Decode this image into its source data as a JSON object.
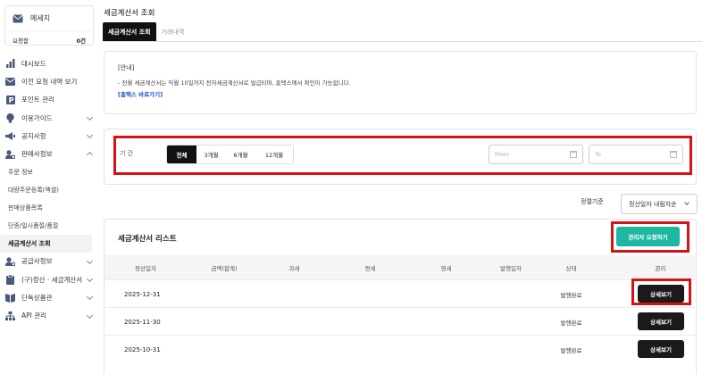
{
  "sidebar": {
    "message": {
      "title": "메세지",
      "request_label": "요청함",
      "request_count": "0건"
    },
    "items": [
      {
        "label": "대시보드",
        "icon": "bar-chart-icon",
        "chevron": ""
      },
      {
        "label": "이전 요청 내역 보기",
        "icon": "mail-icon",
        "chevron": ""
      },
      {
        "label": "포인트 관리",
        "icon": "point-icon",
        "chevron": ""
      },
      {
        "label": "이용가이드",
        "icon": "bulb-icon",
        "chevron": "down"
      },
      {
        "label": "공지사항",
        "icon": "megaphone-icon",
        "chevron": "down"
      },
      {
        "label": "판매사정보",
        "icon": "user-gear-icon",
        "chevron": "up"
      }
    ],
    "sub_items": [
      {
        "label": "주문 정보",
        "active": false
      },
      {
        "label": "대량주문등록(엑셀)",
        "active": false
      },
      {
        "label": "판매상품목록",
        "active": false
      },
      {
        "label": "단종/일시품절/품절",
        "active": false
      },
      {
        "label": "세금계산서 조회",
        "active": true
      }
    ],
    "items2": [
      {
        "label": "공급사정보",
        "icon": "user-gear-icon",
        "chevron": "down"
      },
      {
        "label": "(구)정산 · 세금계산서",
        "icon": "clipboard-icon",
        "chevron": "down"
      },
      {
        "label": "단독상품관",
        "icon": "book-icon",
        "chevron": "down"
      },
      {
        "label": "API 관리",
        "icon": "network-icon",
        "chevron": "down"
      }
    ]
  },
  "page": {
    "title": "세금계산서 조회",
    "tabs": [
      {
        "label": "세금계산서 조회",
        "active": true
      },
      {
        "label": "거래내역",
        "active": false
      }
    ]
  },
  "notice": {
    "title": "[안내]",
    "text": "- 전월 세금계산서는 익월 10일까지 전자세금계산서로 발급되며, 홈택스에서 확인이 가능합니다.",
    "link": "[홈택스 바로가기]"
  },
  "filter": {
    "period_label": "기 간",
    "periods": [
      {
        "label": "전체",
        "active": true
      },
      {
        "label": "3개월",
        "active": false
      },
      {
        "label": "6개월",
        "active": false
      },
      {
        "label": "12개월",
        "active": false
      }
    ],
    "from_placeholder": "From",
    "to_placeholder": "To"
  },
  "sort": {
    "label": "정렬기준",
    "value": "정산일자 내림차순"
  },
  "list": {
    "title": "세금계산서 리스트",
    "request_button": "관리자 요청하기",
    "columns": [
      "정산일자",
      "금액(합계)",
      "과세",
      "면세",
      "영세",
      "발행일자",
      "상태",
      "관리"
    ],
    "rows": [
      {
        "date": "2025-12-31",
        "status": "발행완료",
        "action": "상세보기"
      },
      {
        "date": "2025-11-30",
        "status": "발행완료",
        "action": "상세보기"
      },
      {
        "date": "2025-10-31",
        "status": "발행완료",
        "action": "상세보기"
      }
    ]
  },
  "colors": {
    "accent": "#1fb7a0",
    "highlight": "#d41414",
    "dark": "#111111"
  }
}
